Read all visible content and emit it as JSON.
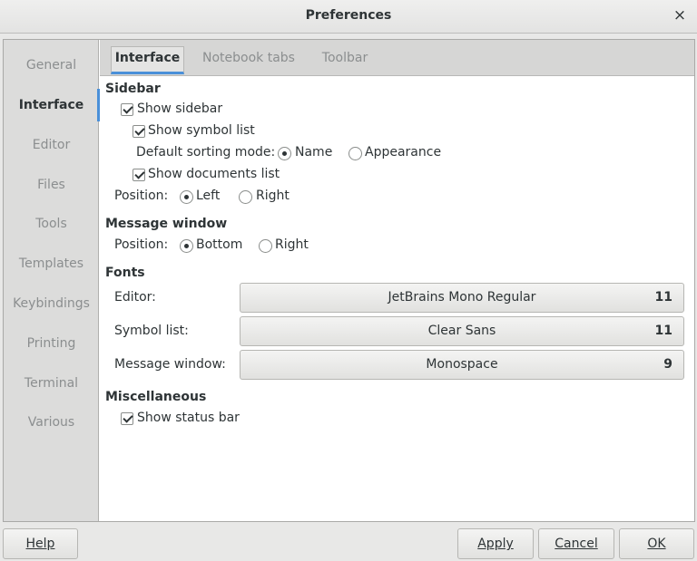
{
  "window": {
    "title": "Preferences",
    "close_glyph": "×"
  },
  "sidebar": {
    "items": [
      {
        "label": "General",
        "active": false
      },
      {
        "label": "Interface",
        "active": true
      },
      {
        "label": "Editor",
        "active": false
      },
      {
        "label": "Files",
        "active": false
      },
      {
        "label": "Tools",
        "active": false
      },
      {
        "label": "Templates",
        "active": false
      },
      {
        "label": "Keybindings",
        "active": false
      },
      {
        "label": "Printing",
        "active": false
      },
      {
        "label": "Terminal",
        "active": false
      },
      {
        "label": "Various",
        "active": false
      }
    ]
  },
  "tabs": [
    {
      "label": "Interface",
      "active": true
    },
    {
      "label": "Notebook tabs",
      "active": false
    },
    {
      "label": "Toolbar",
      "active": false
    }
  ],
  "interface": {
    "sidebar_section": {
      "title": "Sidebar",
      "show_sidebar": {
        "label": "Show sidebar",
        "checked": true
      },
      "show_symbol_list": {
        "label": "Show symbol list",
        "checked": true
      },
      "sorting": {
        "label": "Default sorting mode:",
        "options": [
          {
            "label": "Name",
            "selected": true
          },
          {
            "label": "Appearance",
            "selected": false
          }
        ]
      },
      "show_documents_list": {
        "label": "Show documents list",
        "checked": true
      },
      "position": {
        "label": "Position:",
        "options": [
          {
            "label": "Left",
            "selected": true
          },
          {
            "label": "Right",
            "selected": false
          }
        ]
      }
    },
    "message_window": {
      "title": "Message window",
      "position": {
        "label": "Position:",
        "options": [
          {
            "label": "Bottom",
            "selected": true
          },
          {
            "label": "Right",
            "selected": false
          }
        ]
      }
    },
    "fonts": {
      "title": "Fonts",
      "rows": [
        {
          "label": "Editor:",
          "font": "JetBrains Mono Regular",
          "size": "11"
        },
        {
          "label": "Symbol list:",
          "font": "Clear Sans",
          "size": "11"
        },
        {
          "label": "Message window:",
          "font": "Monospace",
          "size": "9"
        }
      ]
    },
    "misc": {
      "title": "Miscellaneous",
      "show_status_bar": {
        "label": "Show status bar",
        "checked": true
      }
    }
  },
  "buttons": {
    "help": "Help",
    "apply": "Apply",
    "cancel": "Cancel",
    "ok": "OK"
  },
  "colors": {
    "accent": "#4a90d9"
  }
}
